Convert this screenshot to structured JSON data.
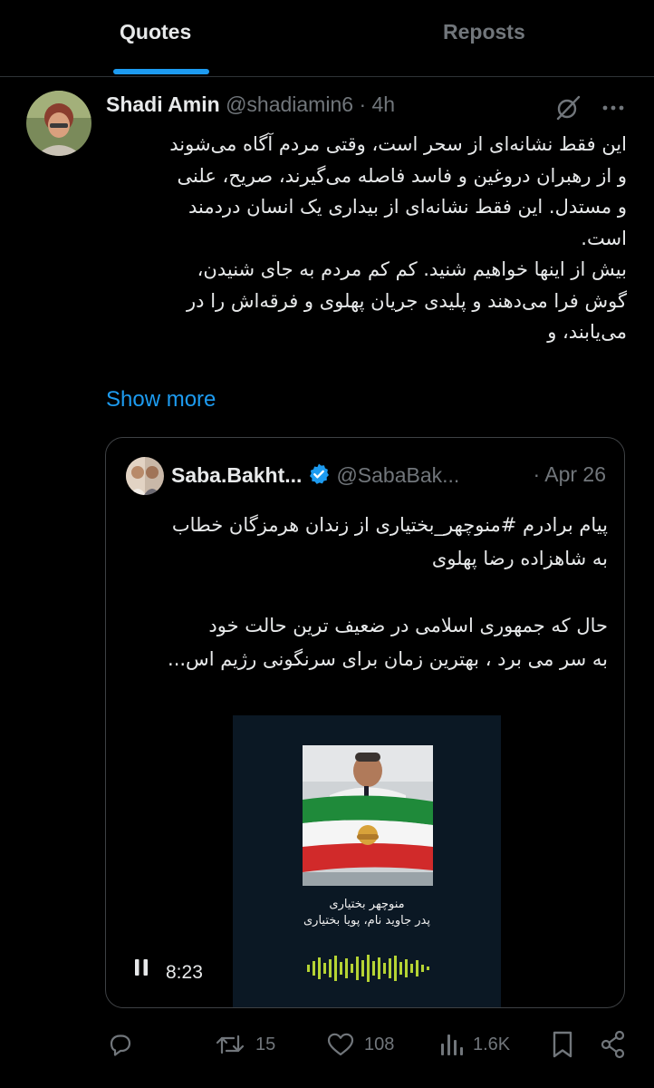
{
  "tabs": {
    "quotes": "Quotes",
    "reposts": "Reposts"
  },
  "post": {
    "author_name": "Shadi Amin",
    "author_handle": "@shadiamin6",
    "separator": "·",
    "time": "4h",
    "body_lines": [
      "این فقط نشانه‌ای از سحر است، وقتی مردم آگاه می‌شوند",
      "و از رهبران دروغین و فاسد فاصله می‌گیرند، صریح، علنی",
      "و مستدل. این فقط نشانه‌ای از بیداری یک انسان دردمند",
      "است.",
      "بیش از اینها خواهیم شنید. کم کم مردم به جای شنیدن،",
      "گوش فرا می‌دهند و پلیدی جریان پهلوی و فرقه‌اش را در",
      "می‌یابند، و"
    ],
    "show_more": "Show more"
  },
  "quoted": {
    "author_name": "Saba.Bakht...",
    "author_handle": "@SabaBak...",
    "separator": "·",
    "date": "Apr 26",
    "text_lines_1": [
      "پیام برادرم #منوچهر_بختیاری از زندان هرمزگان خطاب",
      "به شاهزاده رضا پهلوی"
    ],
    "text_lines_2": [
      "حال که جمهوری اسلامی در ضعیف ترین حالت خود",
      "به سر می برد ، بهترین زمان برای سرنگونی رژیم اس..."
    ],
    "media": {
      "caption_line1": "منوچهر بختیاری",
      "caption_line2": "پدر جاوید نام، پویا بختیاری",
      "duration": "8:23"
    }
  },
  "actions": {
    "replies": "",
    "reposts": "15",
    "likes": "108",
    "views": "1.6K"
  },
  "icons": {
    "reply": "reply-icon",
    "repost": "repost-icon",
    "like": "heart-icon",
    "views": "views-icon",
    "bookmark": "bookmark-icon",
    "share": "share-icon",
    "grok": "grok-icon",
    "more": "more-icon",
    "verified": "verified-badge-icon",
    "pause": "pause-icon"
  },
  "colors": {
    "background": "#000000",
    "accent": "#1d9bf0",
    "text": "#e7e9ea",
    "muted": "#71767b",
    "border": "#2f3336"
  }
}
